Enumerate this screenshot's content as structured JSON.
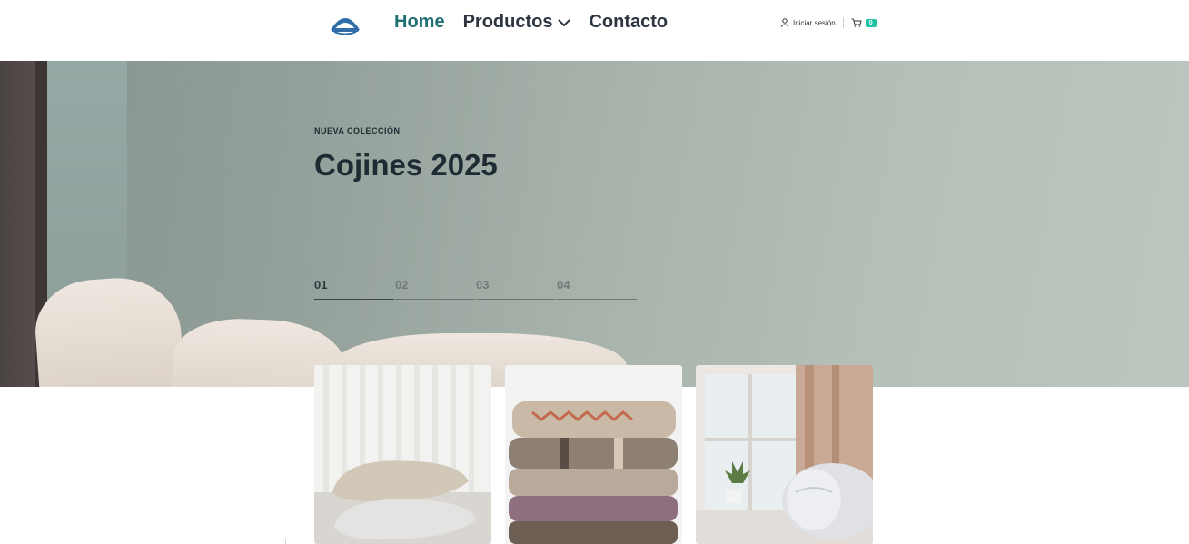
{
  "nav": {
    "items": [
      {
        "label": "Home",
        "active": true
      },
      {
        "label": "Productos",
        "active": false,
        "dropdown": true
      },
      {
        "label": "Contacto",
        "active": false
      }
    ]
  },
  "account": {
    "login_label": "Iniciar sesión",
    "cart_count": "0"
  },
  "hero": {
    "eyebrow": "NUEVA COLECCIÓN",
    "title": "Cojines 2025",
    "slides": [
      "01",
      "02",
      "03",
      "04"
    ],
    "active_slide": "01"
  },
  "products": [
    {
      "image": "pillows-stack-photo"
    },
    {
      "image": "folded-blankets-photo"
    },
    {
      "image": "rolled-duvet-window-photo"
    }
  ],
  "colors": {
    "nav_active": "#1f6f73",
    "nav_text": "#2c3540",
    "cart_badge": "#1fc2a6",
    "hero_bg": "#a6b2aa"
  },
  "icons": [
    "logo-icon",
    "chevron-down-icon",
    "user-icon",
    "cart-icon"
  ]
}
